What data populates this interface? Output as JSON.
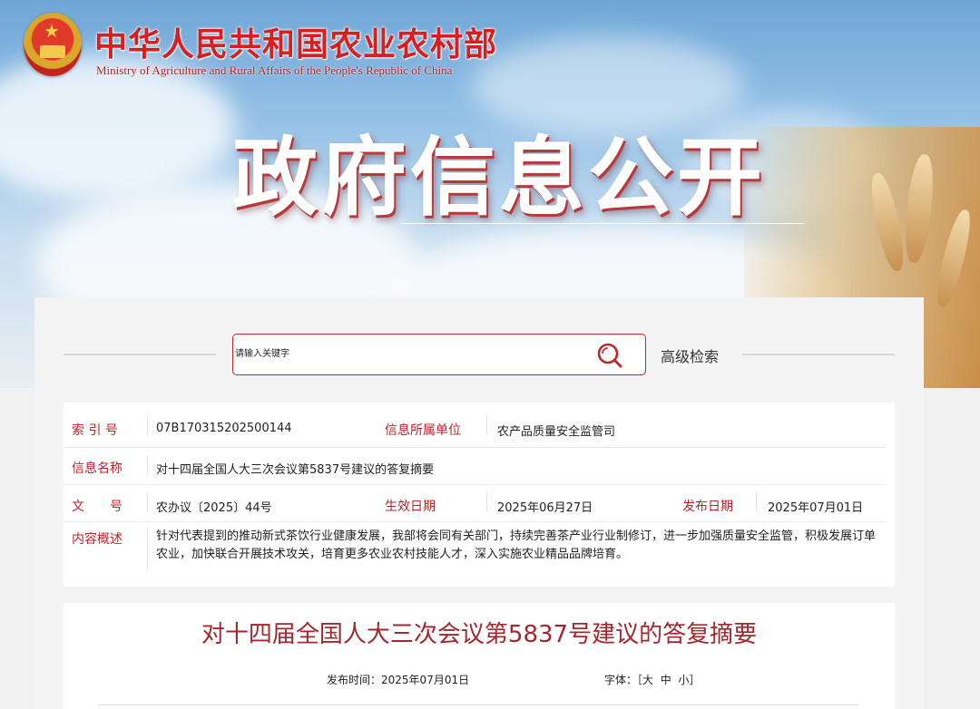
{
  "header": {
    "ministry_name_cn": "中华人民共和国农业农村部",
    "ministry_name_en": "Ministry of Agriculture and Rural Affairs of the People's Republic of China",
    "section_title": "政府信息公开"
  },
  "search": {
    "placeholder": "请输入关键字",
    "advanced_label": "高级检索"
  },
  "info": {
    "index_label": "索 引 号",
    "index_value": "07B170315202500144",
    "unit_label": "信息所属单位",
    "unit_value": "农产品质量安全监管司",
    "name_label": "信息名称",
    "name_value": "对十四届全国人大三次会议第5837号建议的答复摘要",
    "doc_label": "文　　号",
    "doc_value": "农办议〔2025〕44号",
    "effective_label": "生效日期",
    "effective_value": "2025年06月27日",
    "publish_label": "发布日期",
    "publish_value": "2025年07月01日",
    "summary_label": "内容概述",
    "summary_value": "针对代表提到的推动新式茶饮行业健康发展，我部将会同有关部门，持续完善茶产业行业制修订，进一步加强质量安全监管，积极发展订单农业，加快联合开展技术攻关，培育更多农业农村技能人才，深入实施农业精品品牌培育。"
  },
  "article": {
    "title": "对十四届全国人大三次会议第5837号建议的答复摘要",
    "publish_time_label": "发布时间：",
    "publish_time_value": "2025年07月01日",
    "font_label": "字体：",
    "font_open": "［",
    "font_large": "大",
    "font_medium": "中",
    "font_small": "小",
    "font_close": "］"
  },
  "colors": {
    "accent_red": "#b8242a",
    "title_red": "#a5262d"
  }
}
